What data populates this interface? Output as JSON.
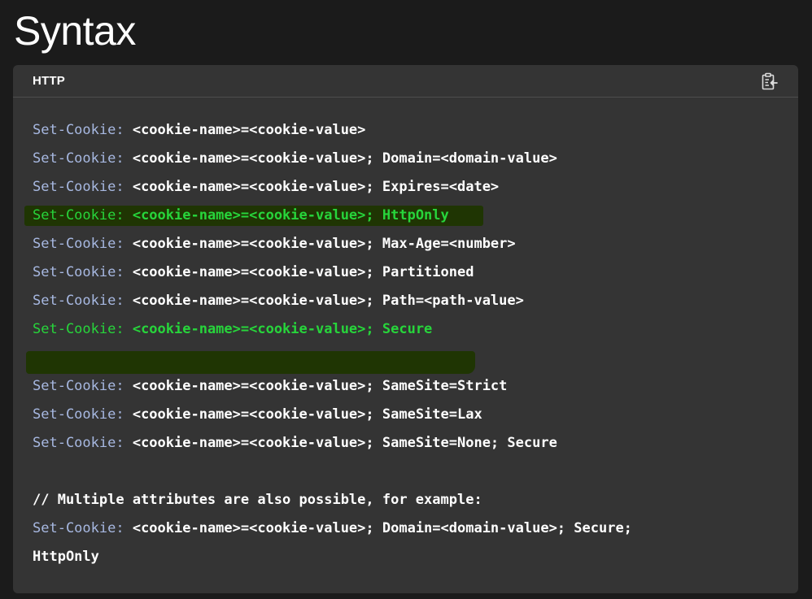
{
  "page": {
    "title": "Syntax"
  },
  "code_block": {
    "language": "HTTP",
    "copy_icon": "clipboard-copy-icon",
    "colors": {
      "background": "#343434",
      "header_key": "#a7b8e1",
      "highlight_text": "#27d53b",
      "highlight_background": "#1f3503"
    },
    "lines": [
      {
        "key": "Set-Cookie:",
        "value": " <cookie-name>=<cookie-value>",
        "highlighted": false
      },
      {
        "key": "Set-Cookie:",
        "value": " <cookie-name>=<cookie-value>; Domain=<domain-value>",
        "highlighted": false
      },
      {
        "key": "Set-Cookie:",
        "value": " <cookie-name>=<cookie-value>; Expires=<date>",
        "highlighted": false
      },
      {
        "key": "Set-Cookie:",
        "value": " <cookie-name>=<cookie-value>; HttpOnly",
        "highlighted": true
      },
      {
        "key": "Set-Cookie:",
        "value": " <cookie-name>=<cookie-value>; Max-Age=<number>",
        "highlighted": false
      },
      {
        "key": "Set-Cookie:",
        "value": " <cookie-name>=<cookie-value>; Partitioned",
        "highlighted": false
      },
      {
        "key": "Set-Cookie:",
        "value": " <cookie-name>=<cookie-value>; Path=<path-value>",
        "highlighted": false
      },
      {
        "key": "Set-Cookie:",
        "value": " <cookie-name>=<cookie-value>; Secure",
        "highlighted": true
      },
      {
        "key": "Set-Cookie:",
        "value": " <cookie-name>=<cookie-value>; SameSite=Strict",
        "highlighted": false
      },
      {
        "key": "Set-Cookie:",
        "value": " <cookie-name>=<cookie-value>; SameSite=Lax",
        "highlighted": false
      },
      {
        "key": "Set-Cookie:",
        "value": " <cookie-name>=<cookie-value>; SameSite=None; Secure",
        "highlighted": false
      },
      {
        "comment": "// Multiple attributes are also possible, for example:"
      },
      {
        "key": "Set-Cookie:",
        "value": " <cookie-name>=<cookie-value>; Domain=<domain-value>; Secure;",
        "highlighted": false
      },
      {
        "value": "HttpOnly",
        "highlighted": false
      }
    ]
  }
}
